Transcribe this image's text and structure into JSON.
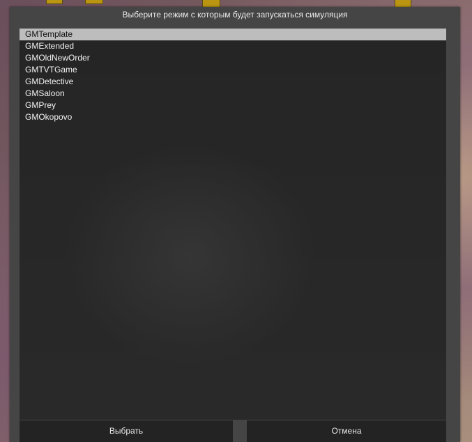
{
  "dialog": {
    "title": "Выберите режим с которым будет запускаться симуляция"
  },
  "modes": {
    "items": [
      {
        "label": "GMTemplate",
        "selected": true
      },
      {
        "label": "GMExtended",
        "selected": false
      },
      {
        "label": "GMOldNewOrder",
        "selected": false
      },
      {
        "label": "GMTVTGame",
        "selected": false
      },
      {
        "label": "GMDetective",
        "selected": false
      },
      {
        "label": "GMSaloon",
        "selected": false
      },
      {
        "label": "GMPrey",
        "selected": false
      },
      {
        "label": "GMOkopovo",
        "selected": false
      }
    ]
  },
  "buttons": {
    "select_label": "Выбрать",
    "cancel_label": "Отмена"
  },
  "colors": {
    "dialog_bg": "#454545",
    "list_bg": "#252525",
    "selection_bg": "#bdbdbd",
    "button_bg": "#232323"
  }
}
